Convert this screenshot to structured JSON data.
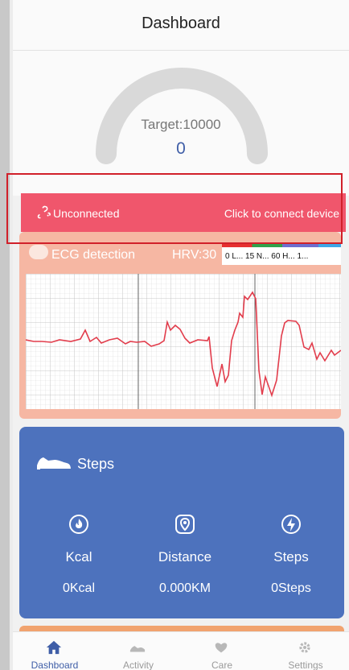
{
  "header": {
    "title": "Dashboard"
  },
  "gauge": {
    "target_label": "Target:10000",
    "current_value": "0",
    "progress_fraction": 0
  },
  "connection": {
    "status": "Unconnected",
    "action": "Click to connect device"
  },
  "ecg": {
    "title": "ECG detection",
    "hrv": "HRV:30",
    "legend_text": "0  L... 15  N... 60  H... 1..."
  },
  "steps_card": {
    "title": "Steps",
    "stats": [
      {
        "label": "Kcal",
        "value": "0Kcal",
        "icon": "flame-icon"
      },
      {
        "label": "Distance",
        "value": "0.000KM",
        "icon": "location-pin-icon"
      },
      {
        "label": "Steps",
        "value": "0Steps",
        "icon": "lightning-icon"
      }
    ]
  },
  "bottom_nav": {
    "items": [
      {
        "label": "Dashboard",
        "icon": "home-icon",
        "active": true
      },
      {
        "label": "Activity",
        "icon": "shoe-icon",
        "active": false
      },
      {
        "label": "Care",
        "icon": "heart-icon",
        "active": false
      },
      {
        "label": "Settings",
        "icon": "gear-icon",
        "active": false
      }
    ]
  },
  "colors": {
    "accent": "#3f5ea7",
    "connect_bar": "#f0566c",
    "ecg_card": "#f6b7a3",
    "steps_card": "#4d72bd",
    "nav_active": "#3f5ea7",
    "nav_inactive": "#9a9a9a"
  }
}
